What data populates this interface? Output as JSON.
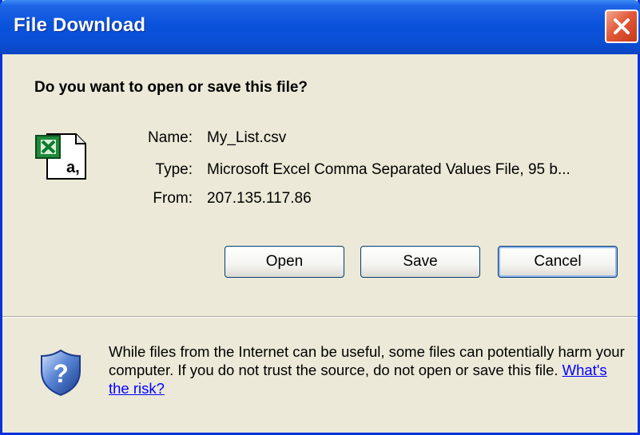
{
  "window": {
    "title": "File Download"
  },
  "dialog": {
    "question": "Do you want to open or save this file?",
    "file": {
      "icon": "excel-csv-file-icon",
      "name_label": "Name:",
      "name_value": "My_List.csv",
      "type_label": "Type:",
      "type_value": "Microsoft Excel Comma Separated Values File, 95 b...",
      "from_label": "From:",
      "from_value": "207.135.117.86"
    },
    "buttons": {
      "open": "Open",
      "save": "Save",
      "cancel": "Cancel"
    },
    "warning": {
      "text": "While files from the Internet can be useful, some files can potentially harm your computer. If you do not trust the source, do not open or save this file.",
      "link": "What's the risk?"
    }
  },
  "colors": {
    "titlebar": "#0a52db",
    "window_bg": "#ece9d8",
    "close_button": "#e2593a",
    "link": "#0000ff"
  }
}
